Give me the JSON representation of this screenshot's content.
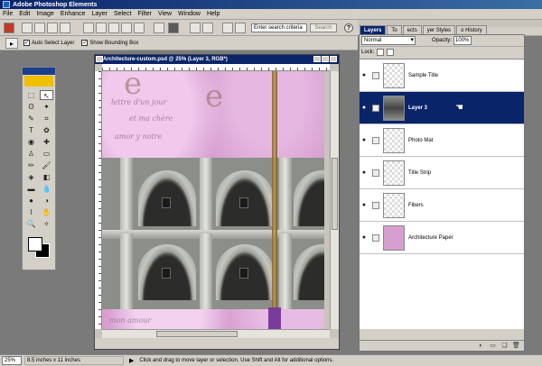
{
  "app": {
    "title": "Adobe Photoshop Elements"
  },
  "menu": [
    "File",
    "Edit",
    "Image",
    "Enhance",
    "Layer",
    "Select",
    "Filter",
    "View",
    "Window",
    "Help"
  ],
  "shortcuts": {
    "search_placeholder": "Enter search criteria",
    "search_button": "Search",
    "help_label": "?"
  },
  "options": {
    "tool_glyph": "▸",
    "auto_select": "Auto Select Layer",
    "show_bounding": "Show Bounding Box",
    "auto_checked": "✓",
    "bound_checked": "✓"
  },
  "document": {
    "title": "Architecture-custom.psd @ 25% (Layer 3, RGB*)"
  },
  "canvas": {
    "script_lines": [
      "lettre d'un jour",
      "et ma chère",
      "amor y notre",
      "mon amour"
    ],
    "big_letters": [
      "e",
      "e"
    ]
  },
  "palette": {
    "tabs": [
      "Layers",
      "To",
      "ects",
      "yer Styles",
      "o History"
    ]
  },
  "layers_panel": {
    "blend_mode": "Normal",
    "opacity_label": "Opacity:",
    "opacity_value": "100%",
    "lock_label": "Lock:",
    "items": [
      {
        "name": "Sample Title"
      },
      {
        "name": "Layer 3"
      },
      {
        "name": "Photo Mat"
      },
      {
        "name": "Title Strip"
      },
      {
        "name": "Fibers"
      },
      {
        "name": "Architecture Paper"
      }
    ]
  },
  "status": {
    "zoom": "25%",
    "doc_size": "8.5 inches x 11 inches",
    "hint": "Click and drag to move layer or selection. Use Shift and Alt for additional options."
  },
  "icons": {
    "eye": "●",
    "cursor": "☚"
  }
}
